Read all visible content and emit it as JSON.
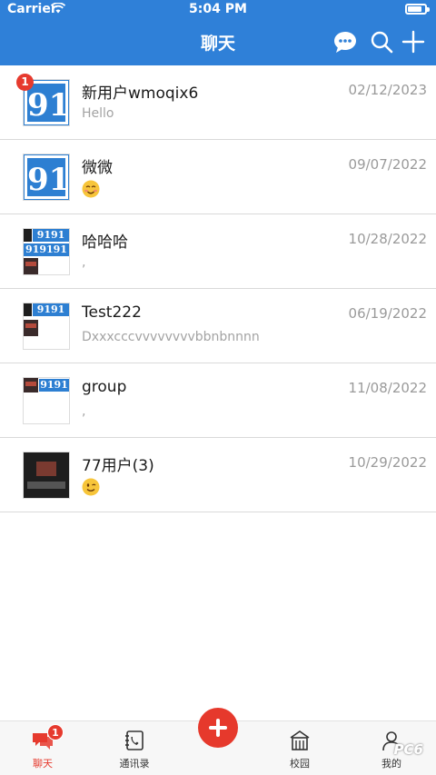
{
  "status_bar": {
    "carrier": "Carrier",
    "time": "5:04 PM",
    "battery_level": 0.85
  },
  "nav": {
    "title": "聊天",
    "icons": [
      "chat-bubble-icon",
      "search-icon",
      "plus-icon"
    ]
  },
  "chats": [
    {
      "name": "新用户wmoqix6",
      "date": "02/12/2023",
      "preview": "Hello",
      "badge": "1",
      "avatar": "91-logo"
    },
    {
      "name": "微微",
      "date": "09/07/2022",
      "preview_emoji": "blushing-smile-emoji",
      "avatar": "91-logo"
    },
    {
      "name": "哈哈哈",
      "date": "10/28/2022",
      "preview": ",",
      "avatar": "group-collage"
    },
    {
      "name": "Test222",
      "date": "06/19/2022",
      "preview": "Dxxxcccvvvvvvvvbbnbnnnn",
      "avatar": "group-collage"
    },
    {
      "name": "group",
      "date": "11/08/2022",
      "preview": ",",
      "avatar": "group-collage"
    },
    {
      "name": "77用户(3)",
      "date": "10/29/2022",
      "preview_emoji": "winking-smile-emoji",
      "avatar": "photo"
    }
  ],
  "tabs": [
    {
      "label": "聊天",
      "icon": "chat-bubbles-icon",
      "badge": "1",
      "active": true
    },
    {
      "label": "通讯录",
      "icon": "contacts-book-icon"
    },
    {
      "label": "校园",
      "icon": "school-building-icon"
    },
    {
      "label": "我的",
      "icon": "user-profile-icon"
    }
  ],
  "center_action": {
    "icon": "plus-icon"
  },
  "watermark": {
    "text": "PC6"
  },
  "colors": {
    "nav_blue": "#2f80d8",
    "badge_red": "#e63a2e",
    "text_dark": "#1a1a1a",
    "text_grey": "#9a9a9a"
  }
}
